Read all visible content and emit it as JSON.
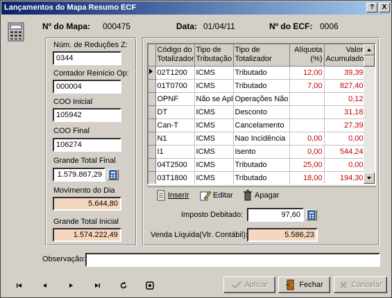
{
  "window": {
    "title": "Lançamentos do Mapa Resumo ECF",
    "help": "?",
    "close": "X"
  },
  "header": {
    "mapa_label": "Nº do Mapa:",
    "mapa_value": "000475",
    "data_label": "Data:",
    "data_value": "01/04/11",
    "ecf_label": "Nº do ECF:",
    "ecf_value": "0006"
  },
  "left": {
    "reducoes_label": "Núm. de Reduções Z:",
    "reducoes_value": "0344",
    "reinicio_label": "Contador Reinício Op:",
    "reinicio_value": "000004",
    "coo_inicial_label": "COO Inicial",
    "coo_inicial_value": "105942",
    "coo_final_label": "COO Final",
    "coo_final_value": "106274",
    "gt_final_label": "Grande Total Final",
    "gt_final_value": "1.579.867,29",
    "movimento_label": "Movimento do Dia",
    "movimento_value": "5.644,80",
    "gt_inicial_label": "Grande Total Inicial",
    "gt_inicial_value": "1.574.222,49"
  },
  "grid": {
    "columns": [
      "Código do Totalizador",
      "Tipo de Tributação",
      "Tipo de Totalizador",
      "Alíquota (%)",
      "Valor Acumulado"
    ],
    "rows": [
      [
        "02T1200",
        "ICMS",
        "Tributado",
        "12,00",
        "39,39"
      ],
      [
        "01T0700",
        "ICMS",
        "Tributado",
        "7,00",
        "827,40"
      ],
      [
        "OPNF",
        "Não se Apli",
        "Operações Não I",
        "",
        "0,12"
      ],
      [
        "DT",
        "ICMS",
        "Desconto",
        "",
        "31,18"
      ],
      [
        "Can-T",
        "ICMS",
        "Cancelamento",
        "",
        "27,39"
      ],
      [
        "N1",
        "ICMS",
        "Nao Incidência",
        "0,00",
        "0,00"
      ],
      [
        "I1",
        "ICMS",
        "Isento",
        "0,00",
        "544,24"
      ],
      [
        "04T2500",
        "ICMS",
        "Tributado",
        "25,00",
        "0,00"
      ],
      [
        "03T1800",
        "ICMS",
        "Tributado",
        "18,00",
        "194,30"
      ]
    ]
  },
  "grid_toolbar": {
    "inserir": "Inserir",
    "editar": "Editar",
    "apagar": "Apagar"
  },
  "totals": {
    "imposto_label": "Imposto Debitado:",
    "imposto_value": "97,60",
    "venda_label": "Venda Líquida(Vlr. Contábil):",
    "venda_value": "5.586,23"
  },
  "observacao": {
    "label": "Observação:",
    "value": ""
  },
  "buttons": {
    "aplicar": "Aplicar",
    "fechar": "Fechar",
    "cancelar": "Cancelar"
  },
  "colors": {
    "title_start": "#0a246a",
    "title_end": "#a6caf0",
    "readonly_bg": "#f5d6bf",
    "value_red": "#c00000"
  }
}
